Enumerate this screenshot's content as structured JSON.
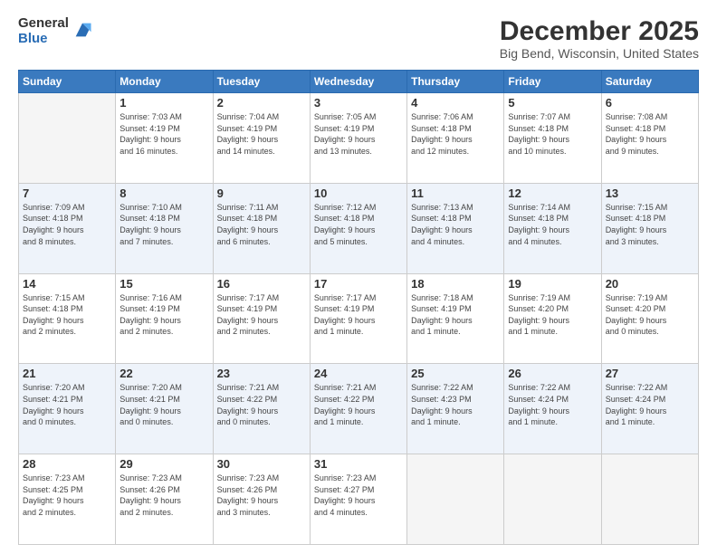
{
  "logo": {
    "general": "General",
    "blue": "Blue"
  },
  "title": "December 2025",
  "subtitle": "Big Bend, Wisconsin, United States",
  "days_of_week": [
    "Sunday",
    "Monday",
    "Tuesday",
    "Wednesday",
    "Thursday",
    "Friday",
    "Saturday"
  ],
  "weeks": [
    [
      {
        "day": "",
        "info": ""
      },
      {
        "day": "1",
        "info": "Sunrise: 7:03 AM\nSunset: 4:19 PM\nDaylight: 9 hours\nand 16 minutes."
      },
      {
        "day": "2",
        "info": "Sunrise: 7:04 AM\nSunset: 4:19 PM\nDaylight: 9 hours\nand 14 minutes."
      },
      {
        "day": "3",
        "info": "Sunrise: 7:05 AM\nSunset: 4:19 PM\nDaylight: 9 hours\nand 13 minutes."
      },
      {
        "day": "4",
        "info": "Sunrise: 7:06 AM\nSunset: 4:18 PM\nDaylight: 9 hours\nand 12 minutes."
      },
      {
        "day": "5",
        "info": "Sunrise: 7:07 AM\nSunset: 4:18 PM\nDaylight: 9 hours\nand 10 minutes."
      },
      {
        "day": "6",
        "info": "Sunrise: 7:08 AM\nSunset: 4:18 PM\nDaylight: 9 hours\nand 9 minutes."
      }
    ],
    [
      {
        "day": "7",
        "info": "Sunrise: 7:09 AM\nSunset: 4:18 PM\nDaylight: 9 hours\nand 8 minutes."
      },
      {
        "day": "8",
        "info": "Sunrise: 7:10 AM\nSunset: 4:18 PM\nDaylight: 9 hours\nand 7 minutes."
      },
      {
        "day": "9",
        "info": "Sunrise: 7:11 AM\nSunset: 4:18 PM\nDaylight: 9 hours\nand 6 minutes."
      },
      {
        "day": "10",
        "info": "Sunrise: 7:12 AM\nSunset: 4:18 PM\nDaylight: 9 hours\nand 5 minutes."
      },
      {
        "day": "11",
        "info": "Sunrise: 7:13 AM\nSunset: 4:18 PM\nDaylight: 9 hours\nand 4 minutes."
      },
      {
        "day": "12",
        "info": "Sunrise: 7:14 AM\nSunset: 4:18 PM\nDaylight: 9 hours\nand 4 minutes."
      },
      {
        "day": "13",
        "info": "Sunrise: 7:15 AM\nSunset: 4:18 PM\nDaylight: 9 hours\nand 3 minutes."
      }
    ],
    [
      {
        "day": "14",
        "info": "Sunrise: 7:15 AM\nSunset: 4:18 PM\nDaylight: 9 hours\nand 2 minutes."
      },
      {
        "day": "15",
        "info": "Sunrise: 7:16 AM\nSunset: 4:19 PM\nDaylight: 9 hours\nand 2 minutes."
      },
      {
        "day": "16",
        "info": "Sunrise: 7:17 AM\nSunset: 4:19 PM\nDaylight: 9 hours\nand 2 minutes."
      },
      {
        "day": "17",
        "info": "Sunrise: 7:17 AM\nSunset: 4:19 PM\nDaylight: 9 hours\nand 1 minute."
      },
      {
        "day": "18",
        "info": "Sunrise: 7:18 AM\nSunset: 4:19 PM\nDaylight: 9 hours\nand 1 minute."
      },
      {
        "day": "19",
        "info": "Sunrise: 7:19 AM\nSunset: 4:20 PM\nDaylight: 9 hours\nand 1 minute."
      },
      {
        "day": "20",
        "info": "Sunrise: 7:19 AM\nSunset: 4:20 PM\nDaylight: 9 hours\nand 0 minutes."
      }
    ],
    [
      {
        "day": "21",
        "info": "Sunrise: 7:20 AM\nSunset: 4:21 PM\nDaylight: 9 hours\nand 0 minutes."
      },
      {
        "day": "22",
        "info": "Sunrise: 7:20 AM\nSunset: 4:21 PM\nDaylight: 9 hours\nand 0 minutes."
      },
      {
        "day": "23",
        "info": "Sunrise: 7:21 AM\nSunset: 4:22 PM\nDaylight: 9 hours\nand 0 minutes."
      },
      {
        "day": "24",
        "info": "Sunrise: 7:21 AM\nSunset: 4:22 PM\nDaylight: 9 hours\nand 1 minute."
      },
      {
        "day": "25",
        "info": "Sunrise: 7:22 AM\nSunset: 4:23 PM\nDaylight: 9 hours\nand 1 minute."
      },
      {
        "day": "26",
        "info": "Sunrise: 7:22 AM\nSunset: 4:24 PM\nDaylight: 9 hours\nand 1 minute."
      },
      {
        "day": "27",
        "info": "Sunrise: 7:22 AM\nSunset: 4:24 PM\nDaylight: 9 hours\nand 1 minute."
      }
    ],
    [
      {
        "day": "28",
        "info": "Sunrise: 7:23 AM\nSunset: 4:25 PM\nDaylight: 9 hours\nand 2 minutes."
      },
      {
        "day": "29",
        "info": "Sunrise: 7:23 AM\nSunset: 4:26 PM\nDaylight: 9 hours\nand 2 minutes."
      },
      {
        "day": "30",
        "info": "Sunrise: 7:23 AM\nSunset: 4:26 PM\nDaylight: 9 hours\nand 3 minutes."
      },
      {
        "day": "31",
        "info": "Sunrise: 7:23 AM\nSunset: 4:27 PM\nDaylight: 9 hours\nand 4 minutes."
      },
      {
        "day": "",
        "info": ""
      },
      {
        "day": "",
        "info": ""
      },
      {
        "day": "",
        "info": ""
      }
    ]
  ]
}
